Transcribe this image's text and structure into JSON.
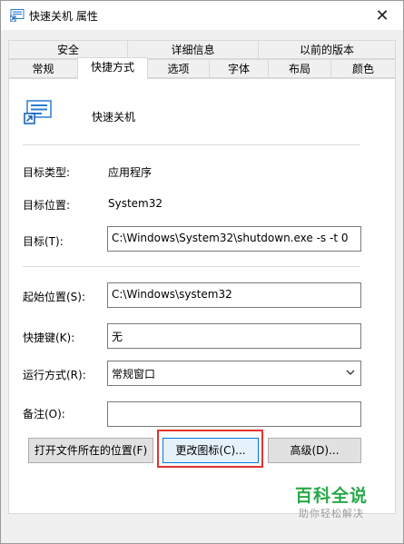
{
  "window": {
    "title": "快速关机 属性",
    "close_glyph": "✕"
  },
  "tabs_row1": [
    "安全",
    "详细信息",
    "以前的版本"
  ],
  "tabs_row2": [
    "常规",
    "快捷方式",
    "选项",
    "字体",
    "布局",
    "颜色"
  ],
  "selected_tab": "快捷方式",
  "shortcut": {
    "name": "快速关机",
    "target_type_label": "目标类型:",
    "target_type_value": "应用程序",
    "target_location_label": "目标位置:",
    "target_location_value": "System32",
    "target_label": "目标(T):",
    "target_value": "C:\\Windows\\System32\\shutdown.exe -s -t 0",
    "start_in_label": "起始位置(S):",
    "start_in_value": "C:\\Windows\\system32",
    "hotkey_label": "快捷键(K):",
    "hotkey_value": "无",
    "run_label": "运行方式(R):",
    "run_value": "常规窗口",
    "comment_label": "备注(O):",
    "comment_value": ""
  },
  "buttons": {
    "open_location": "打开文件所在的位置(F)",
    "change_icon": "更改图标(C)...",
    "advanced": "高级(D)..."
  },
  "watermark": {
    "main": "百科全说",
    "sub": "助你轻松解决"
  },
  "colors": {
    "accent": "#0078d7",
    "highlight": "#e0342f",
    "watermark": "#2aa84a"
  }
}
